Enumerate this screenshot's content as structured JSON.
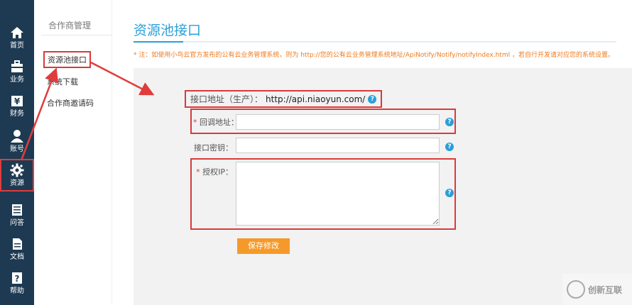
{
  "nav": {
    "items": [
      {
        "label": "首页",
        "icon": "home-icon"
      },
      {
        "label": "业务",
        "icon": "briefcase-icon"
      },
      {
        "label": "财务",
        "icon": "yen-icon"
      },
      {
        "label": "账号",
        "icon": "user-icon"
      },
      {
        "label": "资源",
        "icon": "gear-icon",
        "active": true
      },
      {
        "label": "问答",
        "icon": "list-icon"
      },
      {
        "label": "文档",
        "icon": "document-icon"
      },
      {
        "label": "帮助",
        "icon": "question-icon"
      }
    ]
  },
  "submenu": {
    "title": "合作商管理",
    "items": [
      {
        "label": "资源池接口",
        "active": true
      },
      {
        "label": "系统下载"
      },
      {
        "label": "合作商邀请码"
      }
    ]
  },
  "main": {
    "title": "资源池接口",
    "notice": "* 注：如使用小鸟云官方发布的公有云业务管理系统，则为 http://您的公有云业务管理系统地址/ApiNotify/Notify/notifyIndex.html ，若自行开发请对应您的系统设置。",
    "api_label": "接口地址（生产）：",
    "api_value": "http://api.niaoyun.com/",
    "fields": {
      "callback_label": "回调地址：",
      "secret_label": "接口密钥：",
      "ip_label": "授权IP："
    },
    "save_label": "保存修改",
    "help_glyph": "?"
  },
  "watermark": {
    "text": "创新互联"
  },
  "colors": {
    "nav_bg": "#1e3a52",
    "accent": "#2aa0d8",
    "highlight_red": "#d93a3a",
    "button_orange": "#f59a2a",
    "notice_orange": "#f07a1a"
  }
}
